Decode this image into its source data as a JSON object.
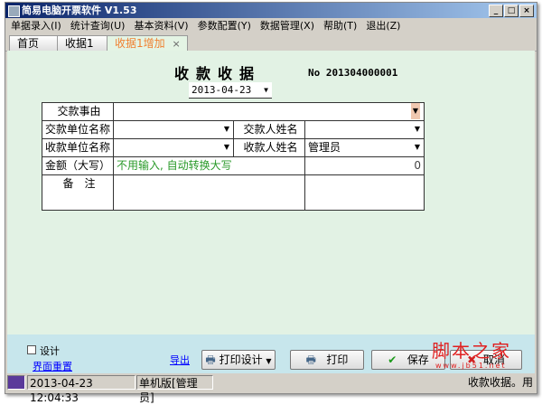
{
  "window": {
    "title": "简易电脑开票软件 V1.53",
    "buttons": [
      "_",
      "□",
      "×"
    ]
  },
  "menu": [
    "单据录入(I)",
    "统计查询(U)",
    "基本资料(V)",
    "参数配置(Y)",
    "数据管理(X)",
    "帮助(T)",
    "退出(Z)"
  ],
  "tabs": [
    {
      "label": "首页"
    },
    {
      "label": "收据1"
    },
    {
      "label": "收据1增加",
      "close": "×"
    }
  ],
  "form": {
    "title": "收款收据",
    "no": "No 201304000001",
    "date": "2013-04-23",
    "labels": {
      "reason": "交款事由",
      "payer_unit": "交款单位名称",
      "payer_name": "交款人姓名",
      "payee_unit": "收款单位名称",
      "payee_name": "收款人姓名",
      "amount": "金额（大写）",
      "remark": "备　注"
    },
    "values": {
      "payee_name": "管理员",
      "amount_hint": "不用输入, 自动转换大写",
      "amount": "0"
    }
  },
  "bottom": {
    "design_label": "设计",
    "reset_link": "界面重置",
    "export_link": "导出",
    "print_design": "打印设计",
    "print": "打印",
    "save": "保存",
    "cancel": "取消"
  },
  "watermark": {
    "text": "脚本之家",
    "url": "www.jb51.net"
  },
  "status": {
    "datetime": "2013-04-23 12:04:33",
    "mode": "单机版[管理员]",
    "message": "收款收据。用"
  }
}
